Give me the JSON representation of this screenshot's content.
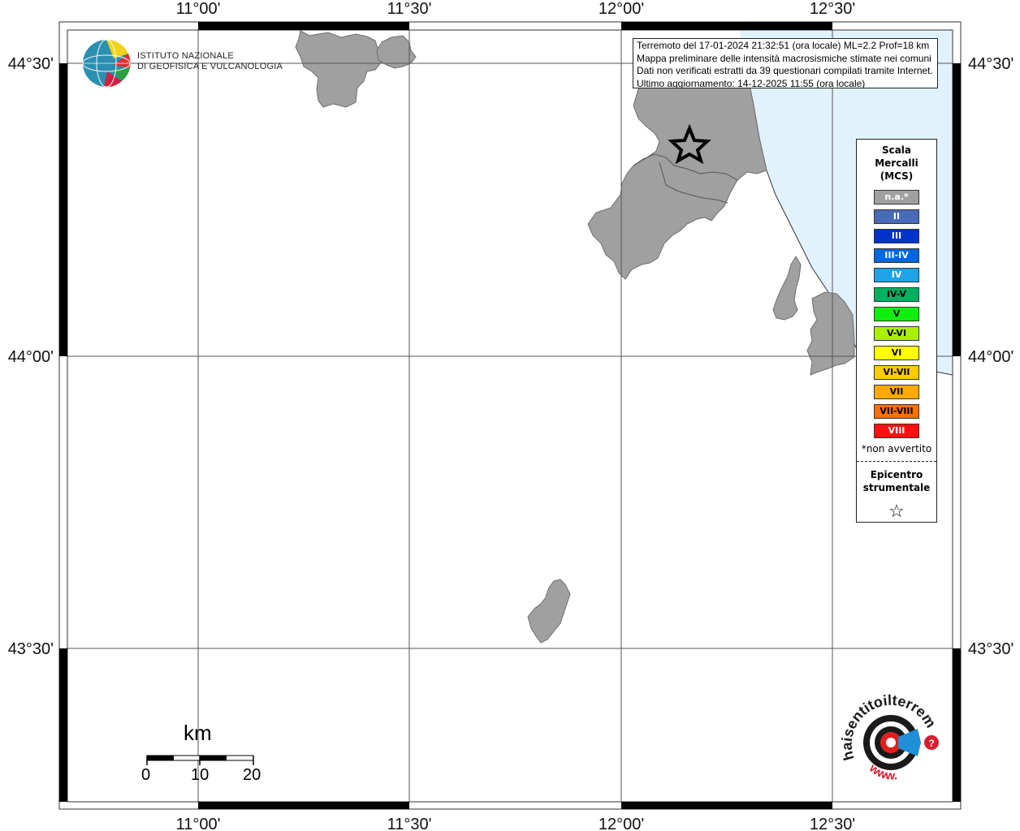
{
  "map": {
    "lon_ticks": [
      "11°00'",
      "11°30'",
      "12°00'",
      "12°30'"
    ],
    "lat_ticks": [
      "44°30'",
      "44°00'",
      "43°30'"
    ],
    "colors": {
      "land": "#a0a0a0",
      "sea": "#e2f2fd",
      "grid": "#555555",
      "frame": "#000000"
    }
  },
  "logo": {
    "line1": "ISTITUTO NAZIONALE",
    "line2": "DI GEOFISICA E VULCANOLOGIA"
  },
  "info": {
    "line1": "Terremoto del 17-01-2024 21:32:51 (ora locale) ML=2.2 Prof=18 km",
    "line2": "Mappa preliminare delle intensità macrosismiche stimate nei comuni",
    "line3": "Dati non verificati estratti da 39 questionari compilati tramite Internet.",
    "line4": "Ultimo aggiornamento: 14-12-2025 11:55 (ora locale)"
  },
  "legend": {
    "title1": "Scala",
    "title2": "Mercalli",
    "title3": "(MCS)",
    "items": [
      {
        "label": "n.a.*",
        "color": "#a0a0a0",
        "text_color": "#ffffff"
      },
      {
        "label": "II",
        "color": "#4a6ab5",
        "text_color": "#ffffff"
      },
      {
        "label": "III",
        "color": "#0033cc",
        "text_color": "#ffffff"
      },
      {
        "label": "III-IV",
        "color": "#0066dd",
        "text_color": "#ffffff"
      },
      {
        "label": "IV",
        "color": "#1fa3e6",
        "text_color": "#ffffff"
      },
      {
        "label": "IV-V",
        "color": "#00b060",
        "text_color": "#000000"
      },
      {
        "label": "V",
        "color": "#10ee10",
        "text_color": "#000000"
      },
      {
        "label": "V-VI",
        "color": "#aaf000",
        "text_color": "#000000"
      },
      {
        "label": "VI",
        "color": "#ffff00",
        "text_color": "#000000"
      },
      {
        "label": "VI-VII",
        "color": "#ffcc00",
        "text_color": "#000000"
      },
      {
        "label": "VII",
        "color": "#ffaa00",
        "text_color": "#000000"
      },
      {
        "label": "VII-VIII",
        "color": "#ff7000",
        "text_color": "#000000"
      },
      {
        "label": "VIII",
        "color": "#ff1010",
        "text_color": "#ffffff"
      }
    ],
    "note": "*non avvertito",
    "epi1": "Epicentro",
    "epi2": "strumentale",
    "star": "☆"
  },
  "scale": {
    "unit": "km",
    "labels": [
      "0",
      "10",
      "20"
    ]
  },
  "badge": {
    "top_text": "haisentitoilterremoto.it",
    "bottom_text": "www.",
    "question": "?"
  }
}
